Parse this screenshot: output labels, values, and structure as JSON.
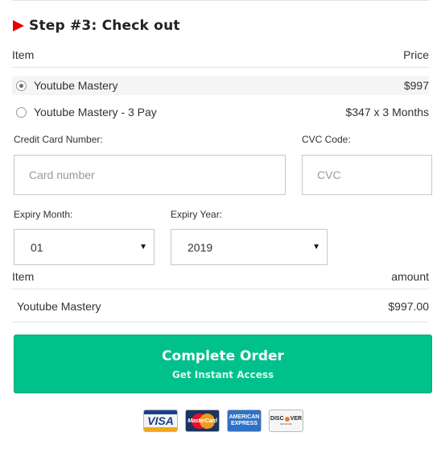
{
  "step": {
    "title": "Step #3: Check out"
  },
  "items_table": {
    "header": {
      "item": "Item",
      "price": "Price"
    },
    "options": [
      {
        "name": "Youtube Mastery",
        "price": "$997",
        "selected": true
      },
      {
        "name": "Youtube Mastery - 3 Pay",
        "price": "$347 x 3 Months",
        "selected": false
      }
    ]
  },
  "payment": {
    "card_number": {
      "label": "Credit Card Number:",
      "placeholder": "Card number",
      "value": ""
    },
    "cvc": {
      "label": "CVC Code:",
      "placeholder": "CVC",
      "value": ""
    },
    "expiry_month": {
      "label": "Expiry Month:",
      "value": "01"
    },
    "expiry_year": {
      "label": "Expiry Year:",
      "value": "2019"
    }
  },
  "summary": {
    "header": {
      "item": "Item",
      "amount": "amount"
    },
    "row": {
      "item": "Youtube Mastery",
      "amount": "$997.00"
    }
  },
  "order_button": {
    "label": "Complete Order",
    "sublabel": "Get Instant Access"
  },
  "cards": {
    "visa": "VISA",
    "mastercard": "MasterCard",
    "amex_line1": "AMERICAN",
    "amex_line2": "EXPRESS",
    "discover": "DISC",
    "discover_end": "VER",
    "discover_sub": "NETWORK"
  },
  "colors": {
    "accent_green": "#00c08b",
    "step_arrow_red": "#e60000"
  }
}
